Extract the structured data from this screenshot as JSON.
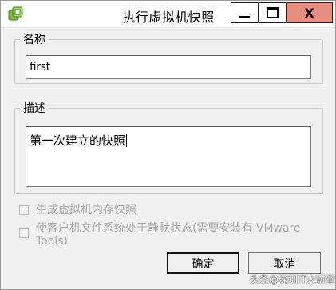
{
  "window": {
    "title": "执行虚拟机快照",
    "close_symbol": "X",
    "accent_close": "#e88e7f"
  },
  "name_group": {
    "legend": "名称",
    "value": "first"
  },
  "desc_group": {
    "legend": "描述",
    "value": "第一次建立的快照"
  },
  "options": [
    {
      "label": "生成虚拟机内存快照",
      "checked": false,
      "enabled": false
    },
    {
      "label": "使客户机文件系统处于静默状态(需要安装有 VMware Tools)",
      "checked": false,
      "enabled": false
    }
  ],
  "buttons": {
    "ok": "确定",
    "cancel": "取消"
  },
  "watermark": "头条@深圳IT大讲堂"
}
